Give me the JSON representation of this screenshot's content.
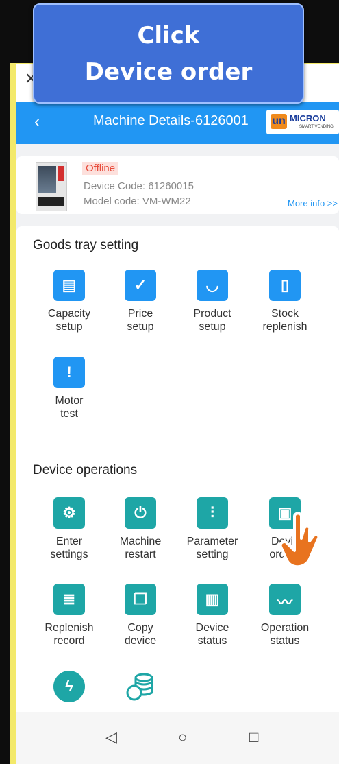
{
  "banner": {
    "line1": "Click",
    "line2": "Device order"
  },
  "header": {
    "title": "Machine Details-6126001",
    "brand": "MICRON",
    "brand_tag": "SMART VENDING"
  },
  "device": {
    "status": "Offline",
    "code": "Device Code:  61260015",
    "model": "Model code:  VM-WM22",
    "more": "More info >>"
  },
  "tray": {
    "title": "Goods tray setting",
    "items": [
      {
        "l1": "Capacity",
        "l2": "setup"
      },
      {
        "l1": "Price",
        "l2": "setup"
      },
      {
        "l1": "Product",
        "l2": "setup"
      },
      {
        "l1": "Stock",
        "l2": "replenish"
      },
      {
        "l1": "Motor",
        "l2": "test"
      }
    ]
  },
  "ops": {
    "title": "Device operations",
    "items": [
      {
        "l1": "Enter",
        "l2": "settings"
      },
      {
        "l1": "Machine",
        "l2": "restart"
      },
      {
        "l1": "Parameter",
        "l2": "setting"
      },
      {
        "l1": "Devic",
        "l2": "orders"
      },
      {
        "l1": "Replenish",
        "l2": "record"
      },
      {
        "l1": "Copy",
        "l2": "device"
      },
      {
        "l1": "Device",
        "l2": "status"
      },
      {
        "l1": "Operation",
        "l2": "status"
      }
    ]
  },
  "icons": [
    "close-icon",
    "back-icon",
    "tray-icon",
    "clipboard-check-icon",
    "bag-icon",
    "phone-icon",
    "alert-icon",
    "gear-icon",
    "power-icon",
    "sliders-icon",
    "orders-icon",
    "record-icon",
    "copy-icon",
    "book-icon",
    "chart-icon",
    "lightning-icon",
    "coins-icon"
  ],
  "colors": {
    "accent": "#2196f3",
    "teal": "#1ea6a6",
    "offline": "#e74c3c",
    "banner": "#3f6fd6"
  }
}
